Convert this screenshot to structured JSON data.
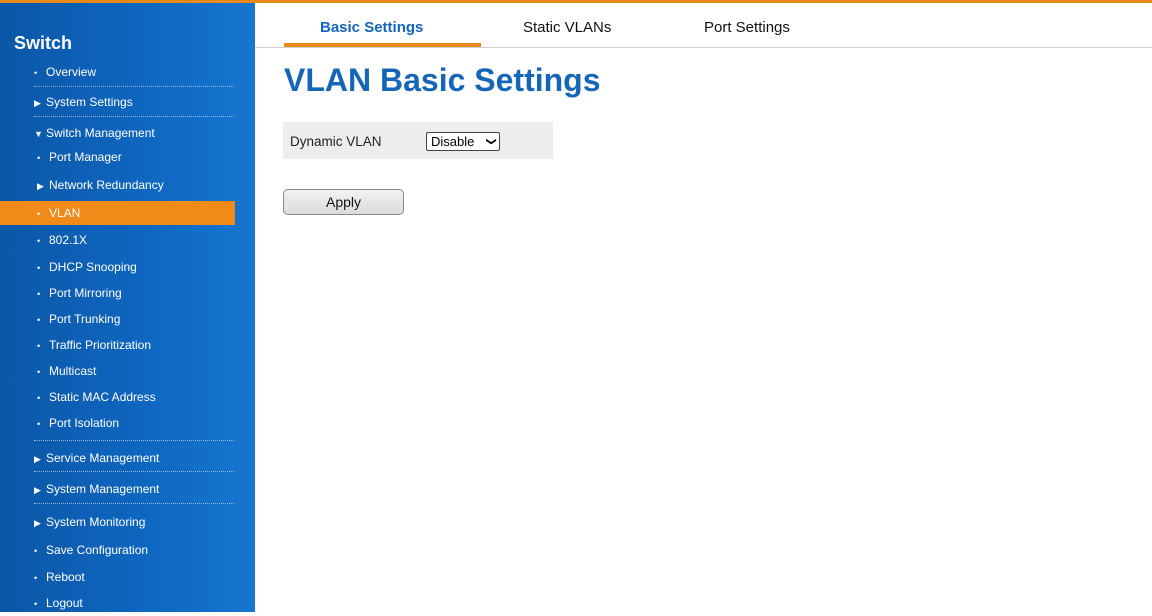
{
  "sidebar": {
    "brand": "Switch",
    "items": [
      {
        "label": "Overview",
        "glyph": "•"
      },
      {
        "label": "System Settings",
        "glyph": "▶"
      },
      {
        "label": "Switch Management",
        "glyph": "▼"
      },
      {
        "label": "Port Manager",
        "glyph": "•"
      },
      {
        "label": "Network Redundancy",
        "glyph": "▶"
      },
      {
        "label": "VLAN",
        "glyph": "•"
      },
      {
        "label": "802.1X",
        "glyph": "•"
      },
      {
        "label": "DHCP Snooping",
        "glyph": "•"
      },
      {
        "label": "Port Mirroring",
        "glyph": "•"
      },
      {
        "label": "Port Trunking",
        "glyph": "•"
      },
      {
        "label": "Traffic Prioritization",
        "glyph": "•"
      },
      {
        "label": "Multicast",
        "glyph": "•"
      },
      {
        "label": "Static MAC Address",
        "glyph": "•"
      },
      {
        "label": "Port Isolation",
        "glyph": "•"
      },
      {
        "label": "Service Management",
        "glyph": "▶"
      },
      {
        "label": "System Management",
        "glyph": "▶"
      },
      {
        "label": "System Monitoring",
        "glyph": "▶"
      },
      {
        "label": "Save Configuration",
        "glyph": "•"
      },
      {
        "label": "Reboot",
        "glyph": "•"
      },
      {
        "label": "Logout",
        "glyph": "•"
      }
    ],
    "active_item": "VLAN"
  },
  "tabs": [
    {
      "label": "Basic Settings"
    },
    {
      "label": "Static VLANs"
    },
    {
      "label": "Port Settings"
    }
  ],
  "main": {
    "title": "VLAN Basic Settings",
    "dynamic_vlan_label": "Dynamic VLAN",
    "dynamic_vlan_value": "Disable",
    "apply_label": "Apply"
  },
  "colors": {
    "sidebar_blue": "#0e66bf",
    "accent_orange": "#f08a18",
    "title_blue": "#1565b8"
  }
}
